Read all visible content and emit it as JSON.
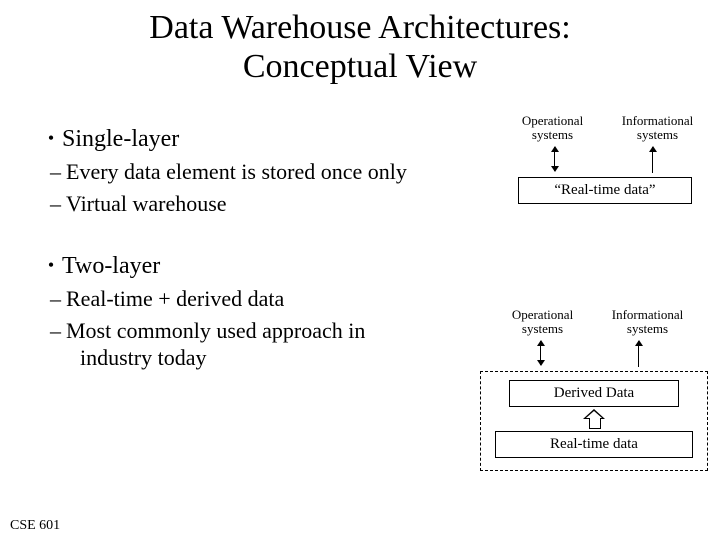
{
  "title_line1": "Data Warehouse Architectures:",
  "title_line2": "Conceptual View",
  "bullets": {
    "single": {
      "label": "Single-layer",
      "sub1": "Every data element is stored once only",
      "sub2": "Virtual warehouse"
    },
    "two": {
      "label": "Two-layer",
      "sub1": "Real-time + derived data",
      "sub2": "Most commonly used approach in",
      "sub2_cont": "industry today"
    }
  },
  "diagram1": {
    "label_left": "Operational systems",
    "label_right": "Informational systems",
    "box": "“Real-time data”"
  },
  "diagram2": {
    "label_left": "Operational systems",
    "label_right": "Informational systems",
    "box_top": "Derived Data",
    "box_bottom": "Real-time data"
  },
  "footer": "CSE 601"
}
